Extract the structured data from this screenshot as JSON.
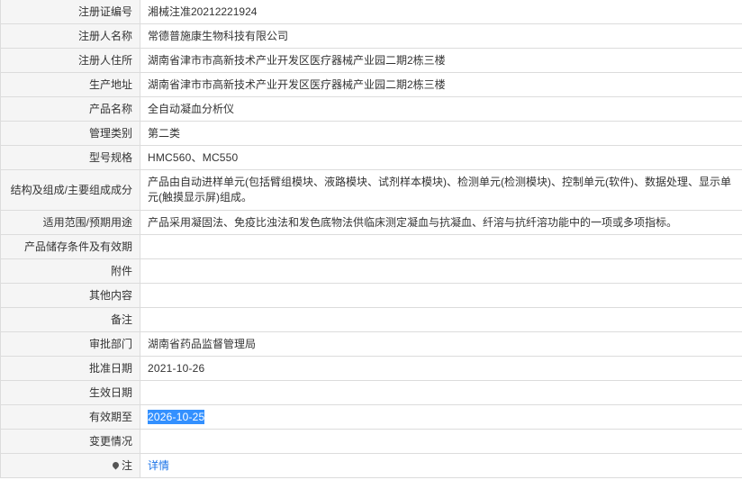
{
  "rows": [
    {
      "label": "注册证编号",
      "value": "湘械注准20212221924"
    },
    {
      "label": "注册人名称",
      "value": "常德普施康生物科技有限公司"
    },
    {
      "label": "注册人住所",
      "value": "湖南省津市市高新技术产业开发区医疗器械产业园二期2栋三楼"
    },
    {
      "label": "生产地址",
      "value": "湖南省津市市高新技术产业开发区医疗器械产业园二期2栋三楼"
    },
    {
      "label": "产品名称",
      "value": "全自动凝血分析仪"
    },
    {
      "label": "管理类别",
      "value": "第二类"
    },
    {
      "label": "型号规格",
      "value": "HMC560、MC550"
    },
    {
      "label": "结构及组成/主要组成成分",
      "value": "产品由自动进样单元(包括臂组模块、液路模块、试剂样本模块)、检测单元(检测模块)、控制单元(软件)、数据处理、显示单元(触摸显示屏)组成。"
    },
    {
      "label": "适用范围/预期用途",
      "value": "产品采用凝固法、免疫比浊法和发色底物法供临床测定凝血与抗凝血、纤溶与抗纤溶功能中的一项或多项指标。"
    },
    {
      "label": "产品储存条件及有效期",
      "value": ""
    },
    {
      "label": "附件",
      "value": ""
    },
    {
      "label": "其他内容",
      "value": ""
    },
    {
      "label": "备注",
      "value": ""
    },
    {
      "label": "审批部门",
      "value": "湖南省药品监督管理局"
    },
    {
      "label": "批准日期",
      "value": "2021-10-26"
    },
    {
      "label": "生效日期",
      "value": ""
    },
    {
      "label": "有效期至",
      "value": "2026-10-25"
    },
    {
      "label": "变更情况",
      "value": ""
    },
    {
      "label": "注",
      "value": "详情"
    }
  ],
  "colors": {
    "label_bg": "#f5f5f5",
    "border": "#dcdcdc",
    "selection": "#3390ff",
    "link": "#1a73e8"
  },
  "icons": {
    "note": "pin-icon"
  }
}
